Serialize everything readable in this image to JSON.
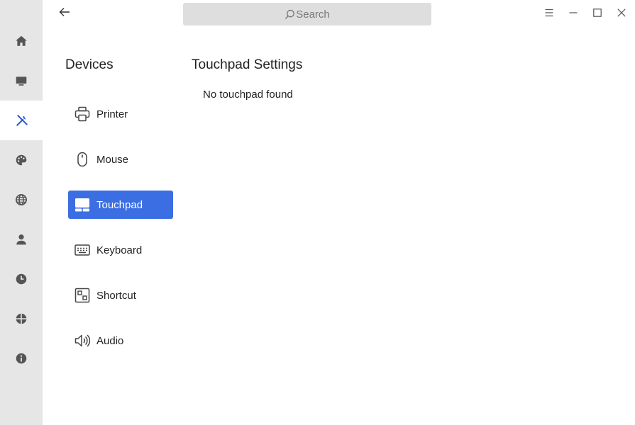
{
  "rail": {
    "items": [
      {
        "icon": "home-icon"
      },
      {
        "icon": "monitor-icon"
      },
      {
        "icon": "tools-icon",
        "active": true
      },
      {
        "icon": "palette-icon"
      },
      {
        "icon": "globe-icon"
      },
      {
        "icon": "user-icon"
      },
      {
        "icon": "clock-icon"
      },
      {
        "icon": "network-icon"
      },
      {
        "icon": "info-icon"
      }
    ],
    "active_color": "#2f5fd4"
  },
  "header": {
    "search_placeholder": "Search"
  },
  "devices": {
    "title": "Devices",
    "items": [
      {
        "label": "Printer",
        "icon": "printer-icon"
      },
      {
        "label": "Mouse",
        "icon": "mouse-icon"
      },
      {
        "label": "Touchpad",
        "icon": "touchpad-icon",
        "active": true
      },
      {
        "label": "Keyboard",
        "icon": "keyboard-icon"
      },
      {
        "label": "Shortcut",
        "icon": "shortcut-icon"
      },
      {
        "label": "Audio",
        "icon": "speaker-icon"
      }
    ],
    "active_color": "#3c6ee3"
  },
  "content": {
    "title": "Touchpad Settings",
    "message": "No touchpad found"
  }
}
